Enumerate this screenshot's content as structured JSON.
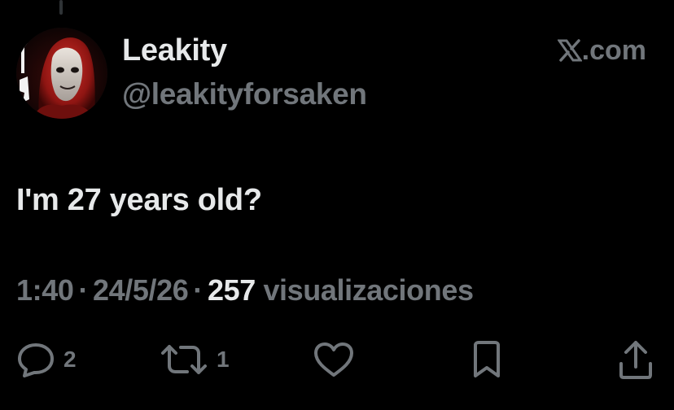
{
  "tweet": {
    "display_name": "Leakity",
    "handle": "@leakityforsaken",
    "brand": ".com",
    "text": "I'm 27 years old?",
    "time": "1:40",
    "separator": "·",
    "date": "24/5/26",
    "views_count": "257",
    "views_label": "visualizaciones"
  },
  "actions": {
    "reply_count": "2",
    "retweet_count": "1",
    "like_icon": "heart-icon",
    "bookmark_icon": "bookmark-icon",
    "share_icon": "share-icon"
  },
  "colors": {
    "background": "#000000",
    "primary_text": "#e7e9ea",
    "secondary_text": "#71767b",
    "avatar_accent": "#b3211e"
  }
}
